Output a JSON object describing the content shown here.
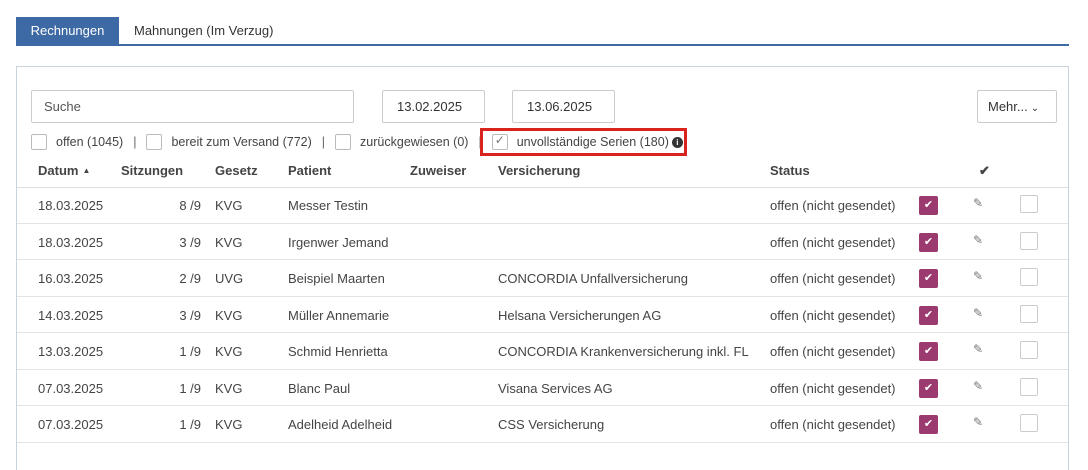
{
  "tabs": [
    {
      "label": "Rechnungen"
    },
    {
      "label": "Mahnungen (Im Verzug)"
    }
  ],
  "toolbar": {
    "search_placeholder": "Suche",
    "date_from": "13.02.2025",
    "date_to": "13.06.2025",
    "more_label": "Mehr...",
    "more_icon": "chevron-down-icon"
  },
  "filters": [
    {
      "label": "offen (1045)",
      "checked": false
    },
    {
      "label": "bereit zum Versand (772)",
      "checked": false
    },
    {
      "label": "zurückgewiesen (0)",
      "checked": false
    },
    {
      "label": "unvollständige Serien (180)",
      "checked": true
    }
  ],
  "filter_separator": "|",
  "highlight_color": "#d9231d",
  "table": {
    "columns": {
      "datum": "Datum",
      "sitzungen": "Sitzungen",
      "gesetz": "Gesetz",
      "patient": "Patient",
      "zuweiser": "Zuweiser",
      "versicherung": "Versicherung",
      "status": "Status",
      "check": "✔"
    },
    "sort_icon": "▲",
    "rows": [
      {
        "datum": "18.03.2025",
        "sitzungen": "8 /9",
        "gesetz": "KVG",
        "patient": "Messer Testin",
        "versicherung": "",
        "status": "offen (nicht gesendet)"
      },
      {
        "datum": "18.03.2025",
        "sitzungen": "3 /9",
        "gesetz": "KVG",
        "patient": "Irgenwer Jemand",
        "versicherung": "",
        "status": "offen (nicht gesendet)"
      },
      {
        "datum": "16.03.2025",
        "sitzungen": "2 /9",
        "gesetz": "UVG",
        "patient": "Beispiel Maarten",
        "versicherung": "CONCORDIA Unfallversicherung",
        "status": "offen (nicht gesendet)"
      },
      {
        "datum": "14.03.2025",
        "sitzungen": "3 /9",
        "gesetz": "KVG",
        "patient": "Müller Annemarie",
        "versicherung": "Helsana Versicherungen AG",
        "status": "offen (nicht gesendet)"
      },
      {
        "datum": "13.03.2025",
        "sitzungen": "1 /9",
        "gesetz": "KVG",
        "patient": "Schmid Henrietta",
        "versicherung": "CONCORDIA Krankenversicherung inkl. FL",
        "status": "offen (nicht gesendet)"
      },
      {
        "datum": "07.03.2025",
        "sitzungen": "1 /9",
        "gesetz": "KVG",
        "patient": "Blanc Paul",
        "versicherung": "Visana Services AG",
        "status": "offen (nicht gesendet)"
      },
      {
        "datum": "07.03.2025",
        "sitzungen": "1 /9",
        "gesetz": "KVG",
        "patient": "Adelheid Adelheid",
        "versicherung": "CSS Versicherung",
        "status": "offen (nicht gesendet)"
      }
    ]
  },
  "colors": {
    "accent": "#3d6aa4",
    "mark": "#9b3a6e"
  }
}
